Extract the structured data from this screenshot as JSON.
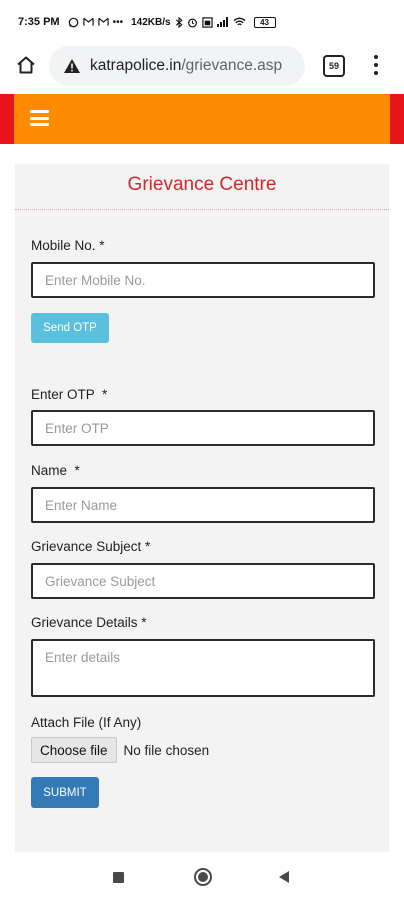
{
  "status_bar": {
    "time": "7:35 PM",
    "icons": [
      "whatsapp-icon",
      "mail-icon",
      "mail-icon",
      "more-icon",
      "bluetooth-icon",
      "alarm-icon",
      "sim-icon",
      "signal-icon",
      "wifi-icon",
      "battery-icon"
    ],
    "network_rate": "142KB/s",
    "battery": "43"
  },
  "browser": {
    "url_domain": "katrapolice.in",
    "url_path": "/grievance.asp",
    "tab_count": "59"
  },
  "form": {
    "title": "Grievance Centre",
    "mobile_label": "Mobile No. *",
    "mobile_placeholder": "Enter Mobile No.",
    "send_otp_label": "Send OTP",
    "otp_label": "Enter OTP  *",
    "otp_placeholder": "Enter OTP",
    "name_label": "Name  *",
    "name_placeholder": "Enter Name",
    "subject_label": "Grievance Subject *",
    "subject_placeholder": "Grievance Subject",
    "details_label": "Grievance Details *",
    "details_placeholder": "Enter details",
    "attach_label": "Attach File (If Any)",
    "choose_file_label": "Choose file",
    "no_file_text": "No file chosen",
    "submit_label": "SUBMIT"
  },
  "colors": {
    "header_orange": "#ff8c00",
    "header_red": "#e8161a",
    "title_red": "#d9262a",
    "otp_button": "#5bc0de",
    "submit_button": "#337ab7"
  }
}
